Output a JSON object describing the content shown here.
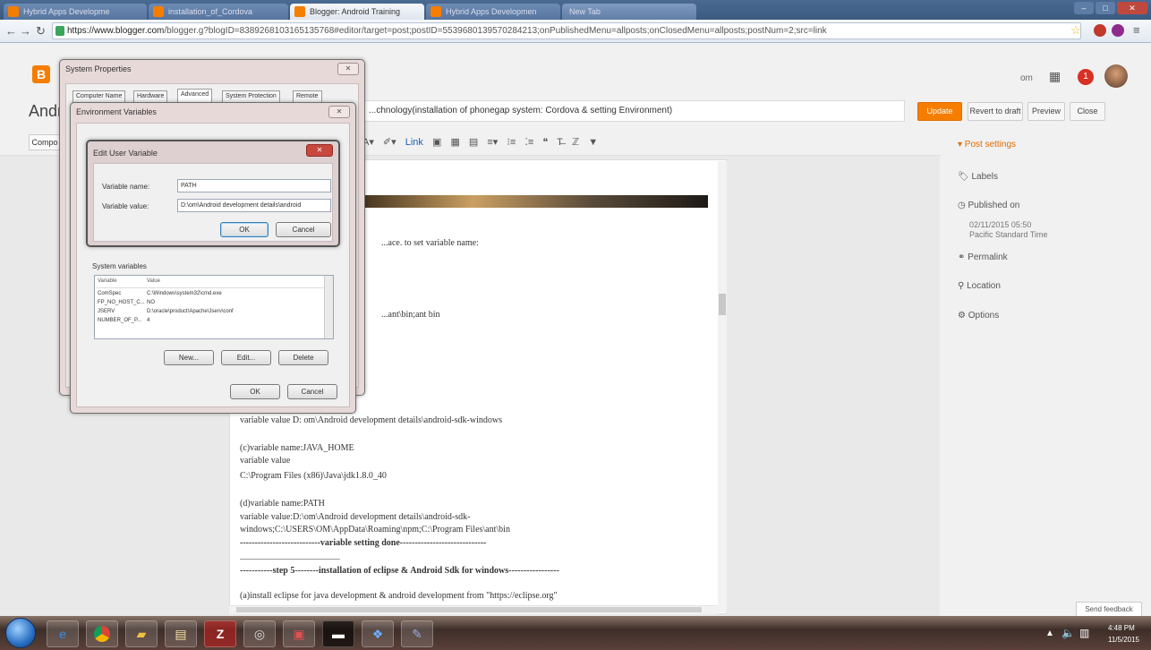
{
  "browser": {
    "tabs": [
      {
        "label": "Hybrid Apps Developme"
      },
      {
        "label": "installation_of_Cordova"
      },
      {
        "label": "Blogger: Android Training"
      },
      {
        "label": "Hybrid Apps Developmen"
      },
      {
        "label": "New Tab"
      }
    ],
    "url_host": "https://www.blogger.com",
    "url_path": "/blogger.g?blogID=8389268103165135768#editor/target=post;postID=5539680139570284213;onPublishedMenu=allposts;onClosedMenu=allposts;postNum=2;src=link"
  },
  "blogger": {
    "logo": "B",
    "header_user": "om",
    "notif_count": "1",
    "post_title_prefix": "Andri",
    "post_title": "...chnology(installation of phonegap system: Cordova & setting Environment)",
    "buttons": {
      "update": "Update",
      "revert": "Revert to draft",
      "preview": "Preview",
      "close": "Close"
    },
    "compose": "Compo",
    "toolbar_tools": [
      "A▾",
      "✐▾",
      "Link",
      "▣",
      "▦",
      "▤",
      "≡▾",
      "⁝≡",
      "⁚≡",
      "❝",
      "T̶",
      "ℤ",
      "▼"
    ]
  },
  "editor": {
    "lines": [
      "...ace. to set variable name:",
      "...ant\\bin;ant bin",
      "variable value D: om\\Android development details\\android-sdk-windows",
      "(c)variable name:JAVA_HOME",
      "variable value",
      "C:\\Program Files (x86)\\Java\\jdk1.8.0_40",
      "(d)variable name:PATH",
      "variable value:D:\\om\\Android development details\\android-sdk-",
      "windows;C:\\USERS\\OM\\AppData\\Roaming\\npm;C:\\Program Files\\ant\\bin",
      "---------------------------variable setting  done-----------------------------",
      "-----------step 5--------installation of eclipse  & Android Sdk for windows-----------------",
      "(a)install eclipse  for java development & android development from   \"https://eclipse.org\""
    ]
  },
  "sidebar": {
    "post_settings": "▾ Post settings",
    "labels": "Labels",
    "published_on": "Published on",
    "published_date": "02/11/2015 05:50",
    "published_tz": "Pacific Standard Time",
    "permalink": "Permalink",
    "location": "Location",
    "options": "Options",
    "send_feedback": "Send feedback"
  },
  "system_properties": {
    "title": "System Properties",
    "tabs": [
      "Computer Name",
      "Hardware",
      "Advanced",
      "System Protection",
      "Remote"
    ]
  },
  "env_vars": {
    "title": "Environment Variables",
    "system_vars_label": "System variables",
    "col_variable": "Variable",
    "col_value": "Value",
    "rows": [
      {
        "name": "ComSpec",
        "value": "C:\\Windows\\system32\\cmd.exe"
      },
      {
        "name": "FP_NO_HOST_C...",
        "value": "NO"
      },
      {
        "name": "JSERV",
        "value": "D:\\oracle\\product\\Apache\\Jserv\\conf"
      },
      {
        "name": "NUMBER_OF_P...",
        "value": "4"
      }
    ],
    "btn_new": "New...",
    "btn_edit": "Edit...",
    "btn_delete": "Delete",
    "btn_ok": "OK",
    "btn_cancel": "Cancel"
  },
  "edit_var": {
    "title": "Edit User Variable",
    "name_label": "Variable name:",
    "name_value": "PATH",
    "value_label": "Variable value:",
    "value_value": "D:\\om\\Android development details\\android",
    "btn_ok": "OK",
    "btn_cancel": "Cancel"
  },
  "taskbar": {
    "time": "4:48 PM",
    "date": "11/5/2015",
    "apps": [
      "IE",
      "Chrome",
      "Folder",
      "Explorer",
      "FileZilla",
      "App",
      "Editor",
      "Cmd",
      "Photos",
      "Vector"
    ]
  }
}
